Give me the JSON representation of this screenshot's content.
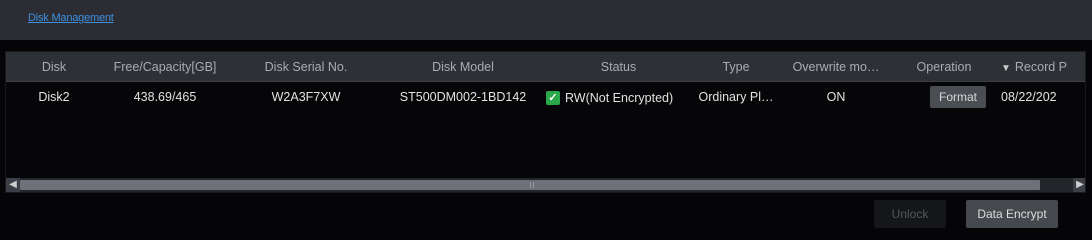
{
  "header": {
    "tab_label": "Disk Management"
  },
  "table": {
    "columns": {
      "disk": "Disk",
      "free_capacity": "Free/Capacity[GB]",
      "serial": "Disk Serial No.",
      "model": "Disk Model",
      "status": "Status",
      "type": "Type",
      "overwrite": "Overwrite mo…",
      "operation": "Operation",
      "record_period": "Record P"
    },
    "rows": [
      {
        "disk": "Disk2",
        "free_capacity": "438.69/465",
        "serial": "W2A3F7XW",
        "model": "ST500DM002-1BD142",
        "status": "RW(Not Encrypted)",
        "type": "Ordinary Pl…",
        "overwrite": "ON",
        "operation_button": "Format",
        "record_period": "08/22/202"
      }
    ]
  },
  "footer": {
    "unlock_label": "Unlock",
    "data_encrypt_label": "Data Encrypt"
  },
  "colors": {
    "accent_link": "#3f8fe0",
    "status_ok": "#2aa84a"
  }
}
